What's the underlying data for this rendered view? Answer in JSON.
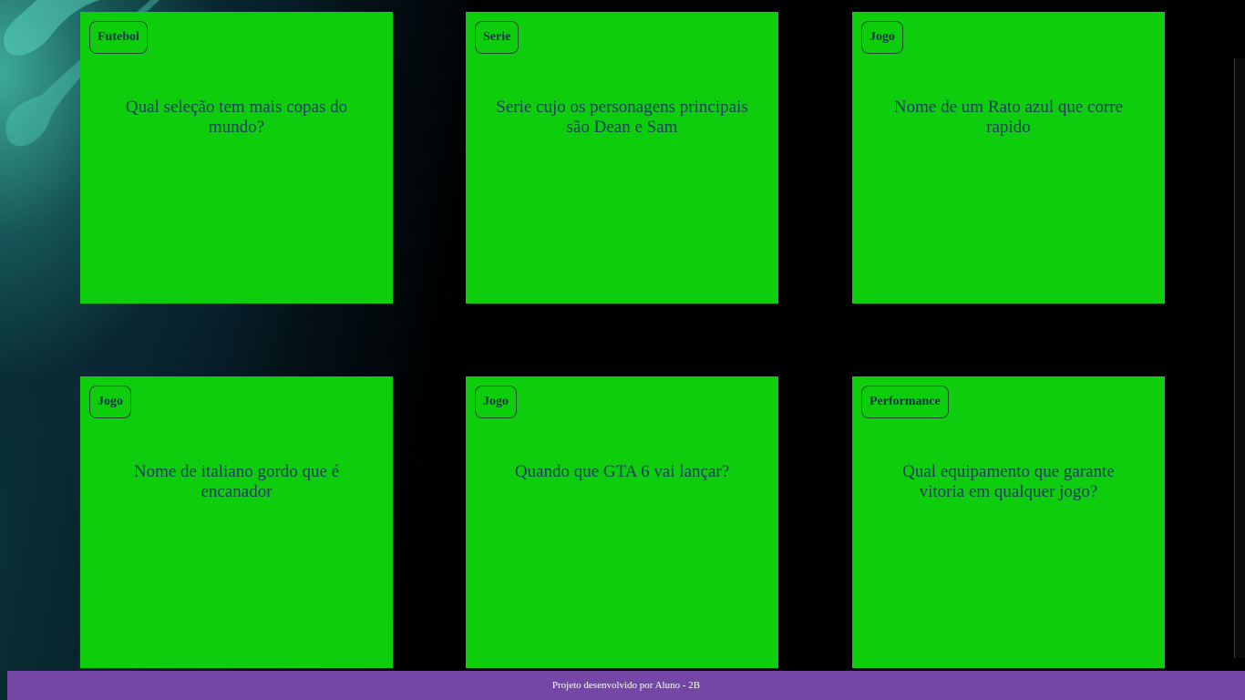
{
  "cards": [
    {
      "tag": "Futebol",
      "question": "Qual seleção tem mais copas do mundo?"
    },
    {
      "tag": "Serie",
      "question": "Serie cujo os personagens principais são Dean e Sam"
    },
    {
      "tag": "Jogo",
      "question": "Nome de um Rato azul que corre rapido"
    },
    {
      "tag": "Jogo",
      "question": "Nome de italiano gordo que é encanador"
    },
    {
      "tag": "Jogo",
      "question": "Quando que GTA 6 vai lançar?"
    },
    {
      "tag": "Performance",
      "question": "Qual equipamento que garante vitoria em qualquer jogo?"
    }
  ],
  "footer": {
    "text": "Projeto desenvolvido por Aluno - 2B"
  },
  "colors": {
    "card_bg": "#0ecd0c",
    "card_text": "#17405a",
    "footer_bg": "#7446a6",
    "page_bg": "#000000"
  }
}
